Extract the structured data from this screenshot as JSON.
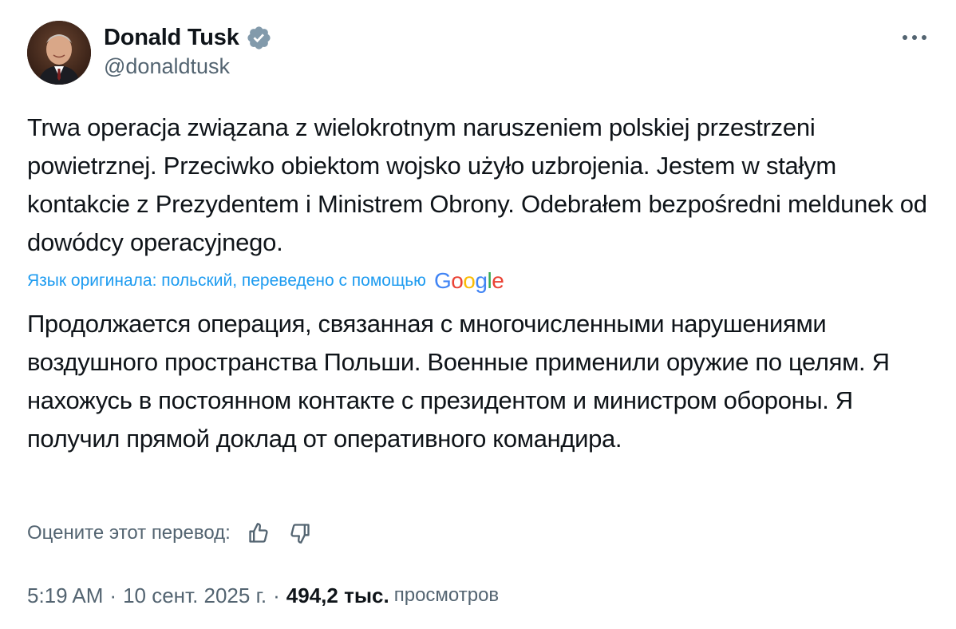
{
  "author": {
    "display_name": "Donald Tusk",
    "handle": "@donaldtusk",
    "verified": true,
    "avatar_icon": "user-avatar"
  },
  "tweet": {
    "original_text": "Trwa operacja związana z wielokrotnym naruszeniem polskiej przestrzeni powietrznej. Przeciwko obiektom wojsko użyło uzbrojenia. Jestem w stałym kontakcie z Prezydentem i Ministrem Obrony. Odebrałem bezpośredni meldunek od dowódcy operacyjnego.",
    "translation_note": "Язык оригинала: польский, переведено с помощью",
    "translation_provider": "Google",
    "translated_text": "Продолжается операция, связанная с многочисленными нарушениями воздушного пространства Польши. Военные применили оружие по целям. Я нахожусь в постоянном контакте с президентом и министром обороны. Я получил прямой доклад от оперативного командира."
  },
  "rating": {
    "label": "Оцените этот перевод:",
    "thumbs_up_icon": "thumbs-up-icon",
    "thumbs_down_icon": "thumbs-down-icon"
  },
  "meta": {
    "time": "5:19 AM",
    "separator": "·",
    "date": "10 сент. 2025 г.",
    "views_count": "494,2 тыс.",
    "views_label": "просмотров"
  },
  "colors": {
    "text_primary": "#0f1419",
    "text_secondary": "#536471",
    "link": "#1d9bf0",
    "verified_badge": "#829aab"
  },
  "icons": {
    "more": "more-horizontal-icon",
    "verified": "verified-badge-icon"
  }
}
